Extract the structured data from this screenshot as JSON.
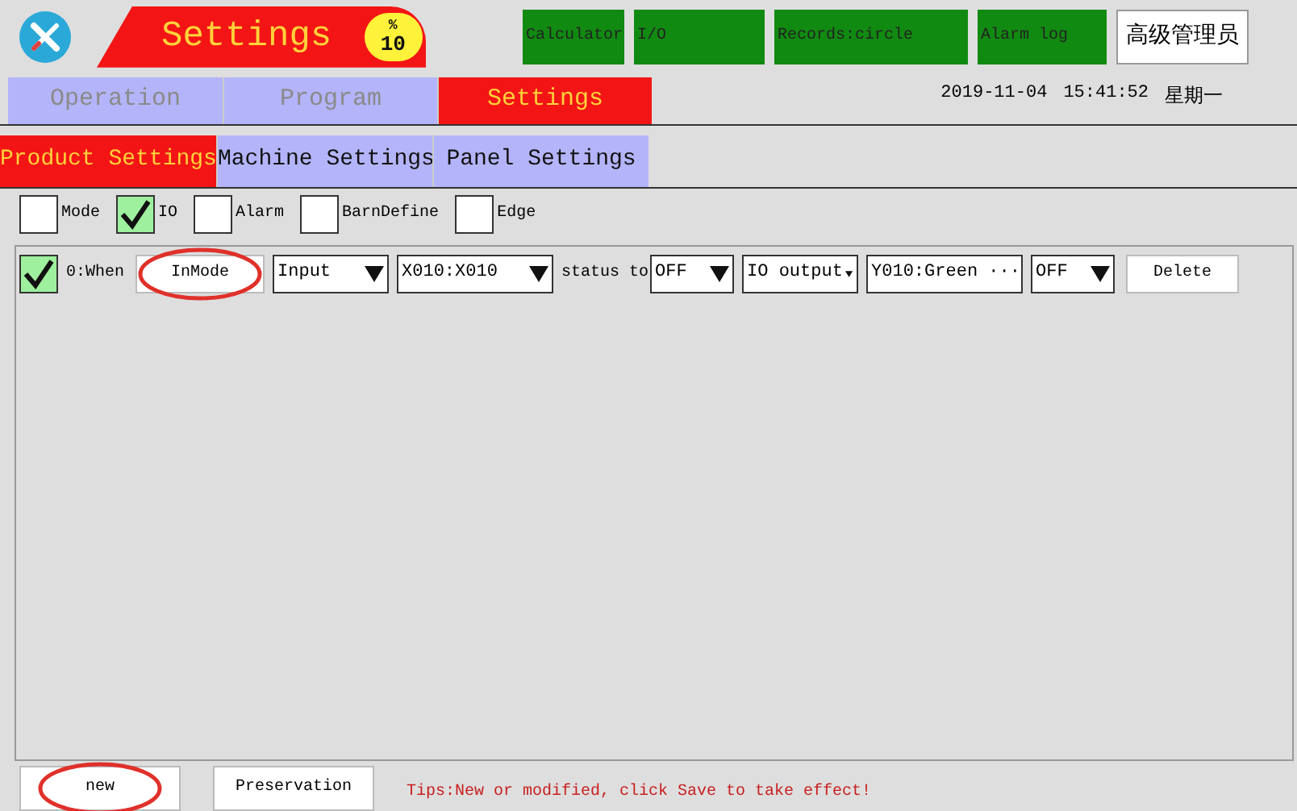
{
  "header": {
    "title": "Settings",
    "badge_symbol": "%",
    "badge_value": "10",
    "top_buttons": [
      {
        "label": "Calculator"
      },
      {
        "label": "I/O"
      },
      {
        "label": "Records:circle"
      },
      {
        "label": "Alarm log"
      }
    ],
    "user_button": "高级管理员"
  },
  "datetime": {
    "date": "2019-11-04",
    "time": "15:41:52",
    "weekday": "星期一"
  },
  "main_tabs": [
    {
      "label": "Operation",
      "selected": false,
      "disabled": true
    },
    {
      "label": "Program",
      "selected": false,
      "disabled": true
    },
    {
      "label": "Settings",
      "selected": true,
      "disabled": false
    }
  ],
  "sub_tabs": [
    {
      "label": "Product Settings",
      "selected": true
    },
    {
      "label": "Machine Settings",
      "selected": false
    },
    {
      "label": "Panel Settings",
      "selected": false
    }
  ],
  "filters": [
    {
      "label": "Mode",
      "checked": false
    },
    {
      "label": "IO",
      "checked": true
    },
    {
      "label": "Alarm",
      "checked": false
    },
    {
      "label": "BarnDefine",
      "checked": false
    },
    {
      "label": "Edge",
      "checked": false
    }
  ],
  "rules": [
    {
      "checked": true,
      "label": "0:When",
      "mode": {
        "label": "InMode",
        "circled": true
      },
      "source_type": "Input",
      "source": "X010:X010",
      "connector": "status to",
      "state": "OFF",
      "output_type": "IO output",
      "output": "Y010:Green ···",
      "output_state": "OFF",
      "delete": "Delete"
    }
  ],
  "footer": {
    "new_button": {
      "label": "new",
      "circled": true
    },
    "save_button": "Preservation",
    "tip": "Tips:New or modified, click Save to take effect!"
  }
}
